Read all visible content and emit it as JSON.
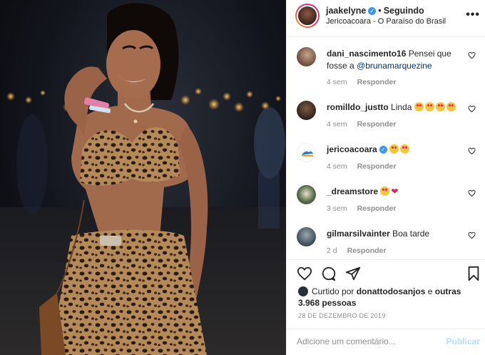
{
  "post": {
    "author": "jaakelyne",
    "follow_status": "Seguindo",
    "location": "Jericoacoara - O Paraíso do Brasil",
    "more_icon": "ellipsis-icon"
  },
  "comments": [
    {
      "user": "dani_nascimento16",
      "text": "Pensei que fosse a ",
      "mention": "@brunamarquezine",
      "time": "4 sem",
      "reply": "Responder"
    },
    {
      "user": "romilldo_justto",
      "text": "Linda",
      "emojis": 4,
      "time": "4 sem",
      "reply": "Responder"
    },
    {
      "user": "jericoacoara",
      "verified": true,
      "text": "",
      "emojis": 2,
      "time": "4 sem",
      "reply": "Responder"
    },
    {
      "user": "_dreamstore",
      "text": "",
      "emojis": 1,
      "heart": "❤",
      "time": "3 sem",
      "reply": "Responder"
    },
    {
      "user": "gilmarsilvainter",
      "text": "Boa tarde",
      "time": "2 d",
      "reply": "Responder"
    }
  ],
  "likes": {
    "prefix": "Curtido por",
    "user": "donattodosanjos",
    "conjunction": "e",
    "others": "outras 3.968 pessoas"
  },
  "date": "28 DE DEZEMBRO DE 2019",
  "add_comment": {
    "placeholder": "Adicione um comentário...",
    "publish_label": "Publicar"
  },
  "colors": {
    "link": "#003569",
    "verified": "#3897f0",
    "publish_disabled": "#b2dffc",
    "muted": "#8e8e8e"
  }
}
